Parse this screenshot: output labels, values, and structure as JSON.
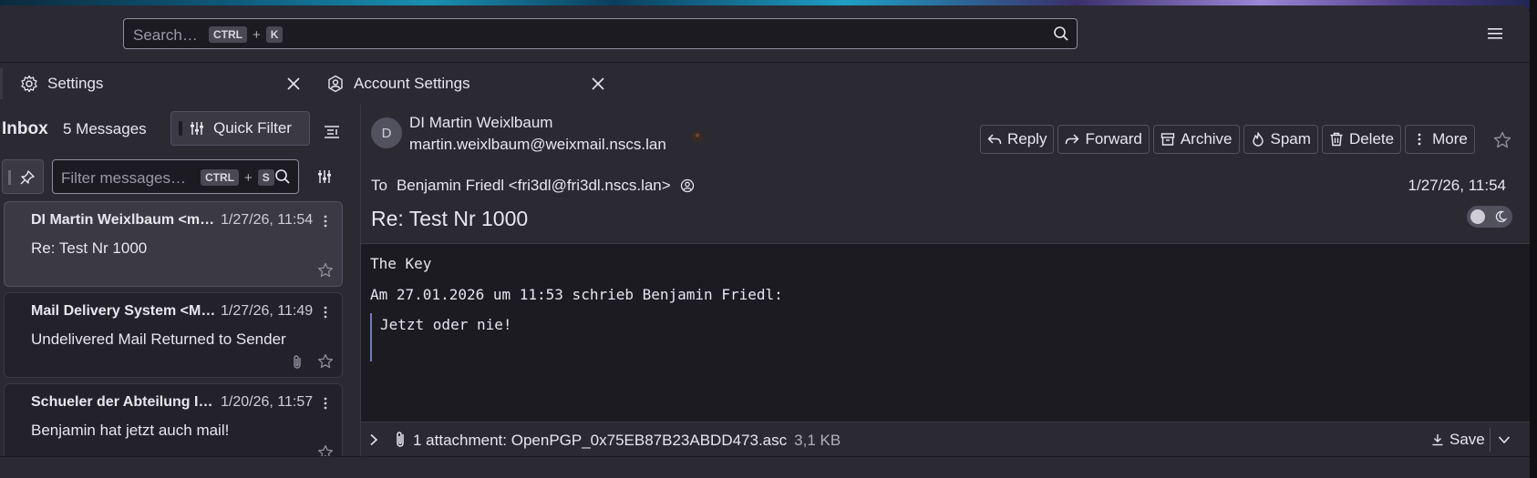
{
  "search": {
    "placeholder": "Search…",
    "key1": "CTRL",
    "plus": "+",
    "key2": "K"
  },
  "tabs": [
    {
      "label": "Settings",
      "icon": "gear-icon"
    },
    {
      "label": "Account Settings",
      "icon": "account-settings-icon"
    }
  ],
  "folder": {
    "title": "Inbox",
    "count": "5 Messages",
    "quick_filter_label": "Quick Filter"
  },
  "filter": {
    "placeholder": "Filter messages…",
    "key1": "CTRL",
    "plus": "+",
    "key2": "S"
  },
  "messages": [
    {
      "sender": "DI Martin Weixlbaum <m…",
      "date": "1/27/26, 11:54",
      "subject": "Re: Test Nr 1000",
      "attachment": false,
      "selected": true
    },
    {
      "sender": "Mail Delivery System <M…",
      "date": "1/27/26, 11:49",
      "subject": "Undelivered Mail Returned to Sender",
      "attachment": true,
      "selected": false
    },
    {
      "sender": "Schueler der Abteilung I…",
      "date": "1/20/26, 11:57",
      "subject": "Benjamin hat jetzt auch mail!",
      "attachment": false,
      "selected": false
    }
  ],
  "header": {
    "avatar_letter": "D",
    "from_name": "DI Martin Weixlbaum",
    "from_email": "martin.weixlbaum@weixmail.nscs.lan",
    "to_label": "To",
    "to_value": "Benjamin Friedl <fri3dl@fri3dl.nscs.lan>",
    "date": "1/27/26, 11:54",
    "subject": "Re: Test Nr 1000",
    "actions": {
      "reply": "Reply",
      "forward": "Forward",
      "archive": "Archive",
      "spam": "Spam",
      "delete": "Delete",
      "more": "More"
    }
  },
  "body": {
    "line1": "The Key",
    "line2": "Am 27.01.2026 um 11:53 schrieb Benjamin Friedl:",
    "quote": "Jetzt oder nie!"
  },
  "attachments": {
    "summary": "1 attachment: OpenPGP_0x75EB87B23ABDD473.asc",
    "size": "3,1 KB",
    "save_label": "Save"
  },
  "colors": {
    "background": "#1c1b22",
    "surface": "#2b2a33",
    "border": "#52515e",
    "quote_bar": "#6f7fb8"
  }
}
